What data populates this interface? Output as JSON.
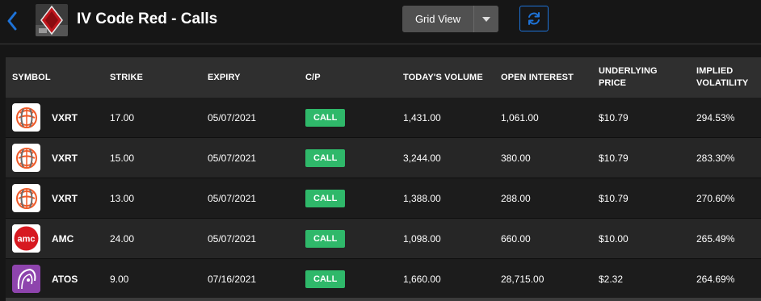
{
  "header": {
    "title": "IV Code Red - Calls",
    "view_select": "Grid View"
  },
  "colors": {
    "background": "#161616",
    "accent": "#1e73d8",
    "call_badge": "#2fb86a",
    "amc_red": "#d71920",
    "atos_purple": "#8e44ad",
    "vxrt_orange": "#f05a28"
  },
  "table": {
    "columns": [
      "SYMBOL",
      "STRIKE",
      "EXPIRY",
      "C/P",
      "TODAY'S VOLUME",
      "OPEN INTEREST",
      "UNDERLYING PRICE",
      "IMPLIED VOLATILITY"
    ],
    "rows": [
      {
        "icon": "vxrt-logo-icon",
        "symbol": "VXRT",
        "strike": "17.00",
        "expiry": "05/07/2021",
        "cp": "CALL",
        "volume": "1,431.00",
        "open_interest": "1,061.00",
        "price": "$10.79",
        "iv": "294.53%"
      },
      {
        "icon": "vxrt-logo-icon",
        "symbol": "VXRT",
        "strike": "15.00",
        "expiry": "05/07/2021",
        "cp": "CALL",
        "volume": "3,244.00",
        "open_interest": "380.00",
        "price": "$10.79",
        "iv": "283.30%"
      },
      {
        "icon": "vxrt-logo-icon",
        "symbol": "VXRT",
        "strike": "13.00",
        "expiry": "05/07/2021",
        "cp": "CALL",
        "volume": "1,388.00",
        "open_interest": "288.00",
        "price": "$10.79",
        "iv": "270.60%"
      },
      {
        "icon": "amc-logo-icon",
        "symbol": "AMC",
        "strike": "24.00",
        "expiry": "05/07/2021",
        "cp": "CALL",
        "volume": "1,098.00",
        "open_interest": "660.00",
        "price": "$10.00",
        "iv": "265.49%"
      },
      {
        "icon": "atos-logo-icon",
        "symbol": "ATOS",
        "strike": "9.00",
        "expiry": "07/16/2021",
        "cp": "CALL",
        "volume": "1,660.00",
        "open_interest": "28,715.00",
        "price": "$2.32",
        "iv": "264.69%"
      }
    ]
  }
}
